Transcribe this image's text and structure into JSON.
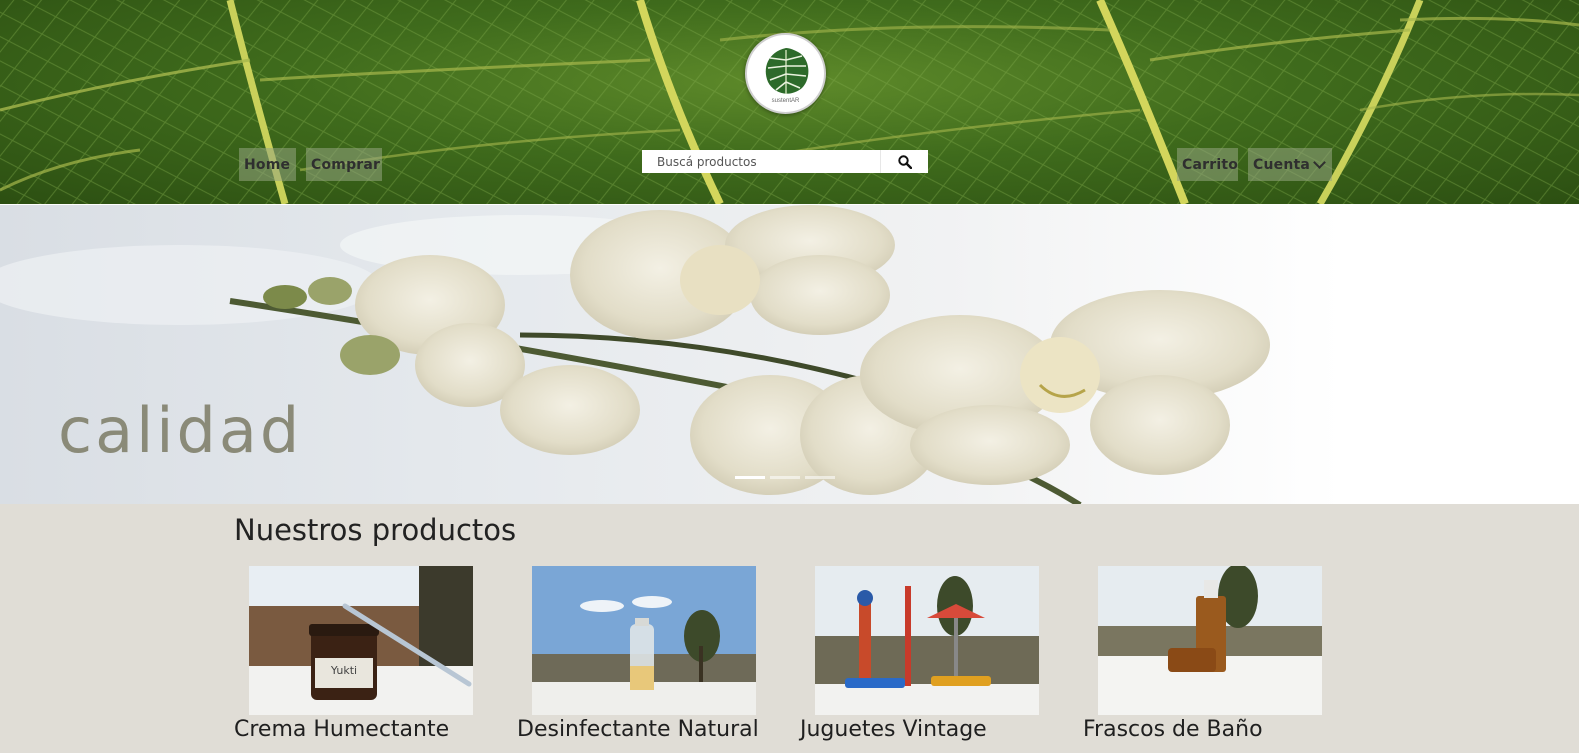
{
  "header": {
    "logo_text": "sustentAR",
    "nav_left": [
      {
        "label": "Home"
      },
      {
        "label": "Comprar"
      }
    ],
    "nav_right": [
      {
        "label": "Carrito"
      },
      {
        "label": "Cuenta"
      }
    ],
    "search": {
      "placeholder": "Buscá productos",
      "value": ""
    },
    "icons": {
      "search": "search-icon",
      "dropdown": "chevron-down-icon",
      "logo": "monstera-leaf-icon"
    }
  },
  "hero": {
    "caption": "calidad",
    "slides_count": 3,
    "active_slide": 1
  },
  "products": {
    "title": "Nuestros productos",
    "items": [
      {
        "name": "Crema Humectante"
      },
      {
        "name": "Desinfectante Natural"
      },
      {
        "name": "Juguetes Vintage"
      },
      {
        "name": "Frascos de Baño"
      }
    ]
  },
  "colors": {
    "page_background": "#e0ddd6",
    "nav_button": "#96a582",
    "leaf_green": "#3f6b1c",
    "caption": "#8a8a78"
  }
}
